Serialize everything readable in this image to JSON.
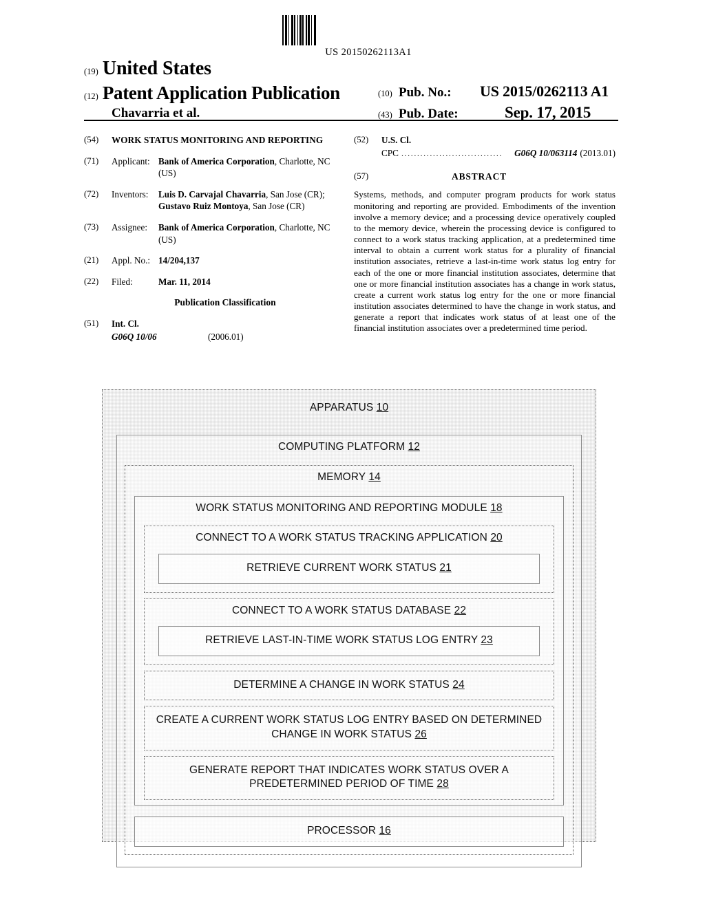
{
  "barcode": {
    "number": "US 20150262113A1"
  },
  "masthead": {
    "code_19": "(19)",
    "country": "United States",
    "code_12": "(12)",
    "doc_type": "Patent Application Publication",
    "author": "Chavarria et al.",
    "code_10": "(10)",
    "pub_no_label": "Pub. No.:",
    "pub_no_value": "US 2015/0262113 A1",
    "code_43": "(43)",
    "pub_date_label": "Pub. Date:",
    "pub_date_value": "Sep. 17, 2015"
  },
  "bibliographic": {
    "title": {
      "code": "(54)",
      "text": "WORK STATUS MONITORING AND REPORTING"
    },
    "applicant": {
      "code": "(71)",
      "key": "Applicant:",
      "name": "Bank of America Corporation",
      "address": ", Charlotte, NC (US)"
    },
    "inventors": {
      "code": "(72)",
      "key": "Inventors:",
      "name1": "Luis D. Carvajal Chavarria",
      "loc1": ", San Jose (CR); ",
      "name2": "Gustavo Ruiz Montoya",
      "loc2": ", San Jose (CR)"
    },
    "assignee": {
      "code": "(73)",
      "key": "Assignee:",
      "name": "Bank of America Corporation",
      "address": ", Charlotte, NC (US)"
    },
    "appl_no": {
      "code": "(21)",
      "key": "Appl. No.:",
      "value": "14/204,137"
    },
    "filed": {
      "code": "(22)",
      "key": "Filed:",
      "value": "Mar. 11, 2014"
    },
    "publication_classification_heading": "Publication Classification",
    "int_cl": {
      "code": "(51)",
      "label": "Int. Cl.",
      "class": "G06Q 10/06",
      "version": "(2006.01)"
    },
    "us_cl": {
      "code": "(52)",
      "label": "U.S. Cl.",
      "cpc_key": "CPC",
      "dots": "................................",
      "cpc_class": "G06Q 10/063114",
      "cpc_version": "(2013.01)"
    },
    "abstract": {
      "code": "(57)",
      "heading": "ABSTRACT",
      "text": "Systems, methods, and computer program products for work status monitoring and reporting are provided. Embodiments of the invention involve a memory device; and a processing device operatively coupled to the memory device, wherein the processing device is configured to connect to a work status tracking application, at a predetermined time interval to obtain a current work status for a plurality of financial institution associates, retrieve a last-in-time work status log entry for each of the one or more financial institution associates, determine that one or more financial institution associates has a change in work status, create a current work status log entry for the one or more financial institution associates determined to have the change in work status, and generate a report that indicates work status of at least one of the financial institution associates over a predetermined time period."
    }
  },
  "figure": {
    "apparatus": {
      "label": "APPARATUS",
      "ref": "10"
    },
    "computing_platform": {
      "label": "COMPUTING PLATFORM",
      "ref": "12"
    },
    "memory": {
      "label": "MEMORY",
      "ref": "14"
    },
    "module": {
      "label": "WORK STATUS MONITORING AND REPORTING MODULE",
      "ref": "18"
    },
    "step_20": {
      "label": "CONNECT TO A WORK STATUS TRACKING APPLICATION",
      "ref": "20"
    },
    "step_21": {
      "label": "RETRIEVE CURRENT WORK STATUS",
      "ref": "21"
    },
    "step_22": {
      "label": "CONNECT TO A WORK STATUS DATABASE",
      "ref": "22"
    },
    "step_23": {
      "label": "RETRIEVE LAST-IN-TIME WORK STATUS LOG ENTRY",
      "ref": "23"
    },
    "step_24": {
      "label": "DETERMINE A CHANGE IN WORK STATUS",
      "ref": "24"
    },
    "step_26": {
      "label": "CREATE A CURRENT WORK STATUS LOG ENTRY BASED ON DETERMINED CHANGE IN WORK STATUS",
      "ref": "26"
    },
    "step_28": {
      "label": "GENERATE REPORT THAT INDICATES WORK STATUS OVER A PREDETERMINED PERIOD OF TIME",
      "ref": "28"
    },
    "processor": {
      "label": "PROCESSOR",
      "ref": "16"
    }
  }
}
